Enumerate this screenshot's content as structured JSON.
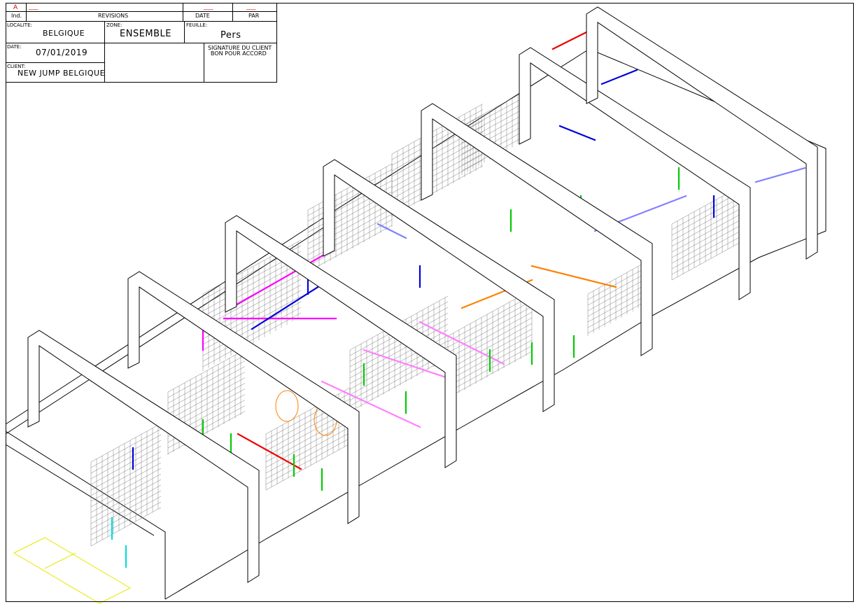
{
  "title_block": {
    "revision": {
      "index": "A",
      "description": "___",
      "date": "___",
      "by": "___"
    },
    "headers": {
      "index": "Ind.",
      "revisions": "REVISIONS",
      "date": "DATE",
      "by": "PAR"
    },
    "locality": {
      "label": "LOCALITE:",
      "value": "BELGIQUE"
    },
    "zone": {
      "label": "ZONE:",
      "value": "ENSEMBLE"
    },
    "sheet": {
      "label": "FEUILLE:",
      "value": "Pers"
    },
    "date": {
      "label": "DATE:",
      "value": "07/01/2019"
    },
    "client": {
      "label": "CLIENT:",
      "value": "NEW JUMP BELGIQUE"
    },
    "signature": {
      "line1": "SIGNATURE DU CLIENT",
      "line2": "BON POUR ACCORD"
    }
  },
  "colors": {
    "outline": "#000000",
    "mesh": "#606060",
    "frame_blue": "#0000dd",
    "violet": "#8080ff",
    "magenta": "#ff00ff",
    "pink": "#ff80ff",
    "green": "#00cc00",
    "cyan": "#00dddd",
    "red": "#ee0000",
    "orange": "#ff8000",
    "yellow": "#e8e800"
  }
}
